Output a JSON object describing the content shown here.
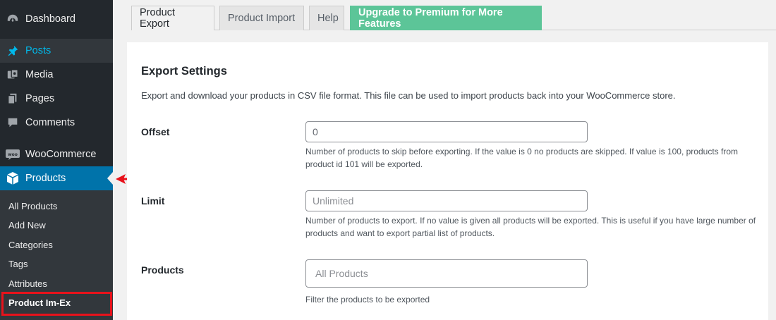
{
  "sidebar": {
    "items": [
      {
        "label": "Dashboard",
        "icon": "dashboard-icon"
      },
      {
        "label": "Posts",
        "icon": "pin-icon"
      },
      {
        "label": "Media",
        "icon": "media-icon"
      },
      {
        "label": "Pages",
        "icon": "pages-icon"
      },
      {
        "label": "Comments",
        "icon": "comments-icon"
      },
      {
        "label": "WooCommerce",
        "icon": "woocommerce-icon"
      },
      {
        "label": "Products",
        "icon": "products-box-icon"
      }
    ],
    "submenu": [
      "All Products",
      "Add New",
      "Categories",
      "Tags",
      "Attributes",
      "Product Im-Ex"
    ]
  },
  "tabs": [
    {
      "label": "Product Export"
    },
    {
      "label": "Product Import"
    },
    {
      "label": "Help"
    },
    {
      "label": "Upgrade to Premium for More Features"
    }
  ],
  "settings": {
    "title": "Export Settings",
    "description": "Export and download your products in CSV file format. This file can be used to import products back into your WooCommerce store.",
    "fields": [
      {
        "label": "Offset",
        "value": "0",
        "help": "Number of products to skip before exporting. If the value is 0 no products are skipped. If value is 100, products from product id 101 will be exported."
      },
      {
        "label": "Limit",
        "placeholder": "Unlimited",
        "help": "Number of products to export. If no value is given all products will be exported. This is useful if you have large number of products and want to export partial list of products."
      },
      {
        "label": "Products",
        "placeholder": "All Products",
        "help": "Filter the products to be exported"
      }
    ]
  },
  "colors": {
    "sidebar_bg": "#23282d",
    "active_menu": "#0073aa",
    "premium_tab": "#5cc598",
    "highlight": "#e8121b"
  }
}
